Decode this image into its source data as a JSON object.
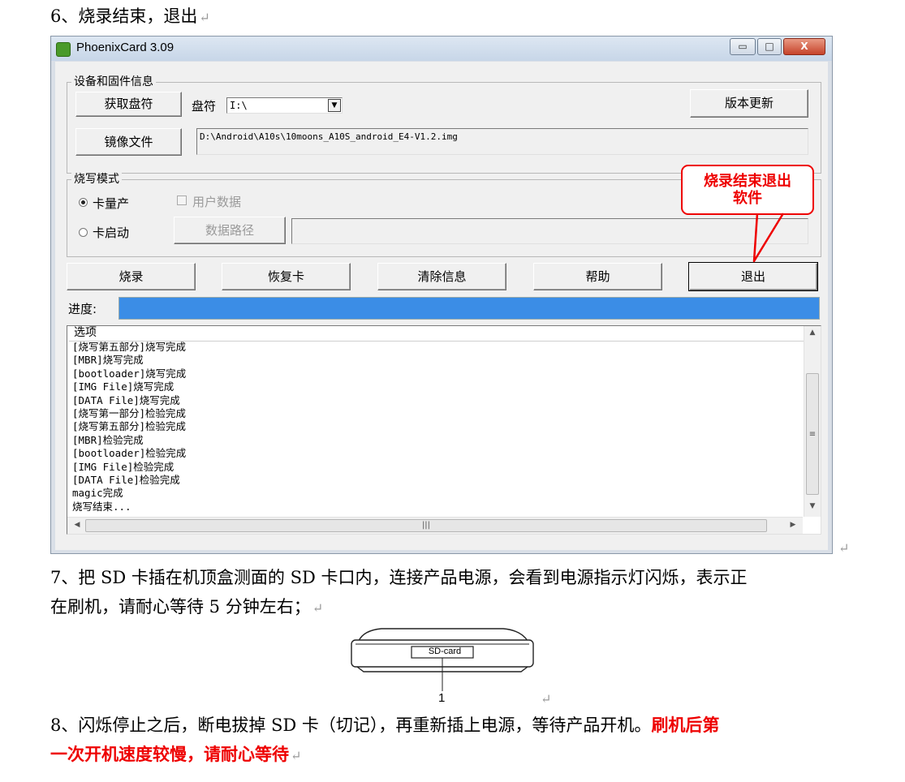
{
  "doc": {
    "step6": "6、烧录结束，退出",
    "step7_line1": "7、把 SD 卡插在机顶盒测面的 SD 卡口内，连接产品电源，会看到电源指示灯闪烁，表示正",
    "step7_line2": "在刷机，请耐心等待 5 分钟左右；",
    "step8_line1_normal": "8、闪烁停止之后，断电拔掉 SD 卡（切记），再重新插上电源，等待产品开机。",
    "step8_line1_red": "刷机后第",
    "step8_line2_red": "一次开机速度较慢，请耐心等待",
    "return_mark": "↵"
  },
  "window": {
    "title": "PhoenixCard 3.09",
    "controls": {
      "minimize": "▭",
      "maximize": "□",
      "close": "X"
    }
  },
  "device_group": {
    "label": "设备和固件信息",
    "get_drive_button": "获取盘符",
    "drive_label": "盘符",
    "drive_value": "I:\\",
    "version_update_button": "版本更新",
    "image_file_button": "镜像文件",
    "image_path": "D:\\Android\\A10s\\10moons_A10S_android_E4-V1.2.img"
  },
  "mode_group": {
    "label": "烧写模式",
    "radio_mass_production": "卡量产",
    "radio_card_boot": "卡启动",
    "checkbox_user_data": "用户数据",
    "data_path_button": "数据路径",
    "selected": "卡量产"
  },
  "callout": {
    "line1": "烧录结束退出",
    "line2": "软件",
    "color": "#ee0000"
  },
  "actions": {
    "burn": "烧录",
    "restore": "恢复卡",
    "clear": "清除信息",
    "help": "帮助",
    "exit": "退出"
  },
  "progress": {
    "label": "进度:",
    "value": 1.0,
    "color": "#3b8de6"
  },
  "log": {
    "header": "选项",
    "lines": [
      "[烧写第五部分]烧写完成",
      "[MBR]烧写完成",
      "[bootloader]烧写完成",
      "[IMG File]烧写完成",
      "[DATA File]烧写完成",
      "[烧写第一部分]检验完成",
      "[烧写第五部分]检验完成",
      "[MBR]检验完成",
      "[bootloader]检验完成",
      "[IMG File]检验完成",
      "[DATA File]检验完成",
      "magic完成",
      "烧写结束..."
    ]
  },
  "device_image": {
    "slot_label": "SD-card",
    "callout_number": "1"
  }
}
